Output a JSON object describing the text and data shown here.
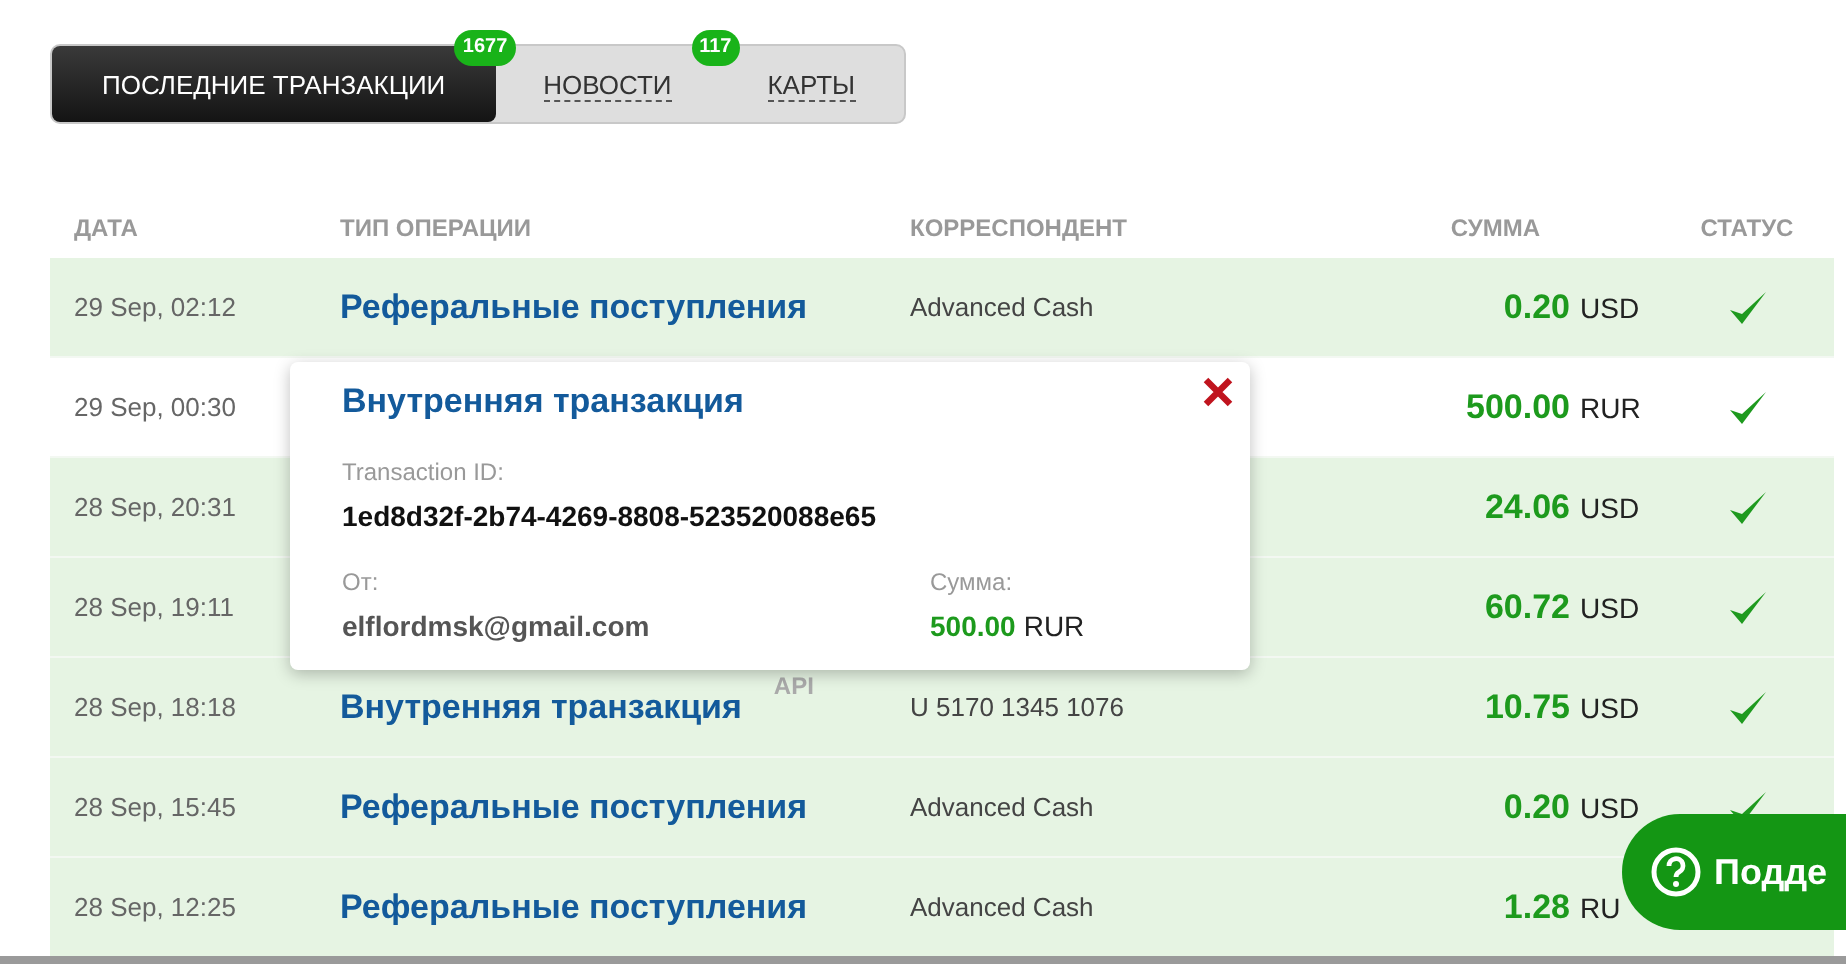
{
  "tabs": [
    {
      "label": "ПОСЛЕДНИЕ ТРАНЗАКЦИИ",
      "selected": true,
      "badge": "1677"
    },
    {
      "label": "НОВОСТИ",
      "selected": false,
      "badge": "117"
    },
    {
      "label": "КАРТЫ",
      "selected": false
    }
  ],
  "table": {
    "columns": [
      "ДАТА",
      "ТИП ОПЕРАЦИИ",
      "КОРРЕСПОНДЕНТ",
      "СУММА",
      "СТАТУС"
    ],
    "rows": [
      {
        "date": "29 Sep, 02:12",
        "type": "Реферальные поступления",
        "correspondent": "Advanced Cash",
        "amount": "0.20",
        "currency": "USD",
        "highlighted": true,
        "status_ok": true
      },
      {
        "date": "29 Sep, 00:30",
        "amount": "500.00",
        "currency": "RUR",
        "highlighted": false,
        "status_ok": true
      },
      {
        "date": "28 Sep, 20:31",
        "amount": "24.06",
        "currency": "USD",
        "highlighted": true,
        "status_ok": true
      },
      {
        "date": "28 Sep, 19:11",
        "amount": "60.72",
        "currency": "USD",
        "highlighted": true,
        "status_ok": true
      },
      {
        "date": "28 Sep, 18:18",
        "type": "Внутренняя транзакция",
        "badge": "API",
        "correspondent": "U 5170 1345 1076",
        "amount": "10.75",
        "currency": "USD",
        "highlighted": true,
        "status_ok": true
      },
      {
        "date": "28 Sep, 15:45",
        "type": "Реферальные поступления",
        "correspondent": "Advanced Cash",
        "amount": "0.20",
        "currency": "USD",
        "highlighted": true,
        "status_ok": true
      },
      {
        "date": "28 Sep, 12:25",
        "type": "Реферальные поступления",
        "correspondent": "Advanced Cash",
        "amount": "1.28",
        "currency": "RU",
        "highlighted": true,
        "status_ok": false
      }
    ]
  },
  "popup": {
    "title": "Внутренняя транзакция",
    "id_label": "Transaction ID:",
    "id": "1ed8d32f-2b74-4269-8808-523520088e65",
    "from_label": "От:",
    "from": "elflordmsk@gmail.com",
    "sum_label": "Сумма:",
    "sum_amount": "500.00",
    "sum_currency": "RUR"
  },
  "support_button": {
    "label": "Подде"
  }
}
